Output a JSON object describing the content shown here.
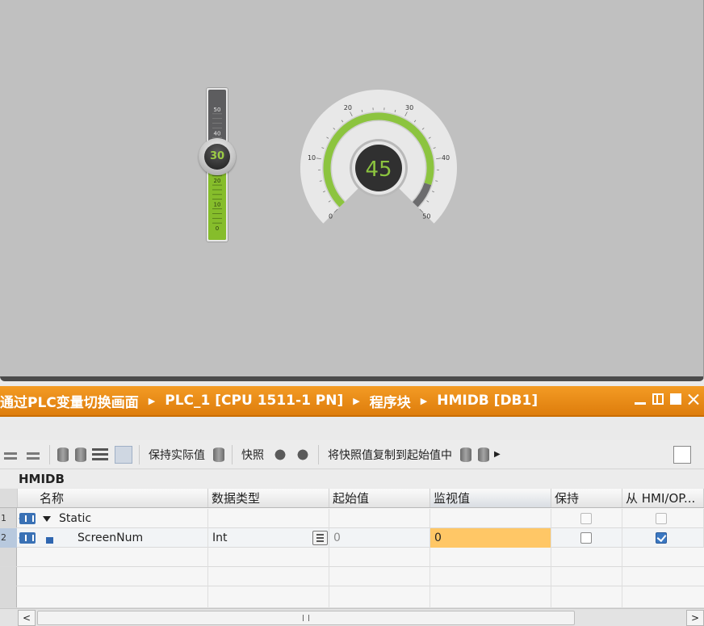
{
  "hmi": {
    "slider": {
      "value": "30",
      "fraction": 0.6,
      "tick_labels": [
        "50",
        "40",
        "30",
        "20",
        "10",
        "0"
      ]
    },
    "gauge": {
      "value": "45",
      "fraction": 0.9,
      "tick_labels": [
        "0",
        "10",
        "20",
        "30",
        "40",
        "50"
      ],
      "accent_color": "#8cc43f"
    }
  },
  "title_bar": {
    "crumbs": [
      "通过PLC变量切换画面",
      "PLC_1 [CPU 1511-1 PN]",
      "程序块",
      "HMIDB [DB1]"
    ],
    "color": "#f29522"
  },
  "toolbar": {
    "keep_actual_label": "保持实际值",
    "snapshot_label": "快照",
    "copy_snapshot_label": "将快照值复制到起始值中"
  },
  "block_name": "HMIDB",
  "table": {
    "columns": [
      "名称",
      "数据类型",
      "起始值",
      "监视值",
      "保持",
      "从 HMI/OP..."
    ],
    "rows": [
      {
        "num": "1",
        "name": "Static",
        "type": "",
        "start": "",
        "monitor": "",
        "retain": false,
        "hmi": false
      },
      {
        "num": "2",
        "name": "ScreenNum",
        "type": "Int",
        "start": "0",
        "monitor": "0",
        "retain": false,
        "hmi": true
      }
    ],
    "monitor_highlight": "#ffc766"
  }
}
